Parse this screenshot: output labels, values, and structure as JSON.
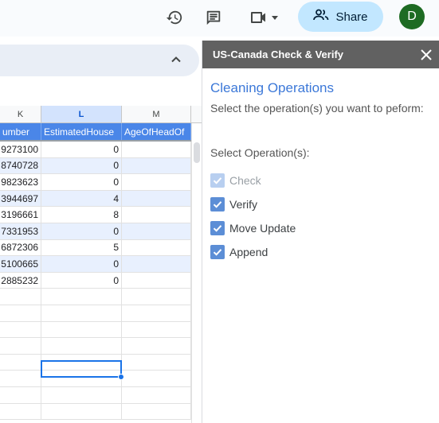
{
  "toolbar": {
    "history_icon": "history-icon",
    "comment_icon": "comment-icon",
    "meet_icon": "video-camera-icon",
    "share_label": "Share",
    "avatar_initial": "D",
    "avatar_color": "#1e6b23",
    "share_bg": "#c2e7ff"
  },
  "sheet": {
    "columns": [
      {
        "letter": "K"
      },
      {
        "letter": "L",
        "selected": true
      },
      {
        "letter": "M"
      }
    ],
    "header_row": {
      "k": "umber",
      "l": "EstimatedHouse",
      "m": "AgeOfHeadOf"
    },
    "rows": [
      {
        "k": "9273100",
        "l": "0"
      },
      {
        "k": "8740728",
        "l": "0"
      },
      {
        "k": "9823623",
        "l": "0"
      },
      {
        "k": "3944697",
        "l": "4"
      },
      {
        "k": "3196661",
        "l": "8"
      },
      {
        "k": "7331953",
        "l": "0"
      },
      {
        "k": "6872306",
        "l": "5"
      },
      {
        "k": "5100665",
        "l": "0"
      },
      {
        "k": "2885232",
        "l": "0"
      }
    ],
    "header_color": "#4a86e8",
    "band_color": "#e8f0fe"
  },
  "panel": {
    "title": "US-Canada Check & Verify",
    "section_title": "Cleaning Operations",
    "instructions": "Select the operation(s) you want to peform:",
    "operations_label": "Select Operation(s):",
    "operations": [
      {
        "label": "Check",
        "checked": true,
        "disabled": true
      },
      {
        "label": "Verify",
        "checked": true,
        "disabled": false
      },
      {
        "label": "Move Update",
        "checked": true,
        "disabled": false
      },
      {
        "label": "Append",
        "checked": true,
        "disabled": false
      }
    ],
    "accent_color": "#3c78d8"
  }
}
